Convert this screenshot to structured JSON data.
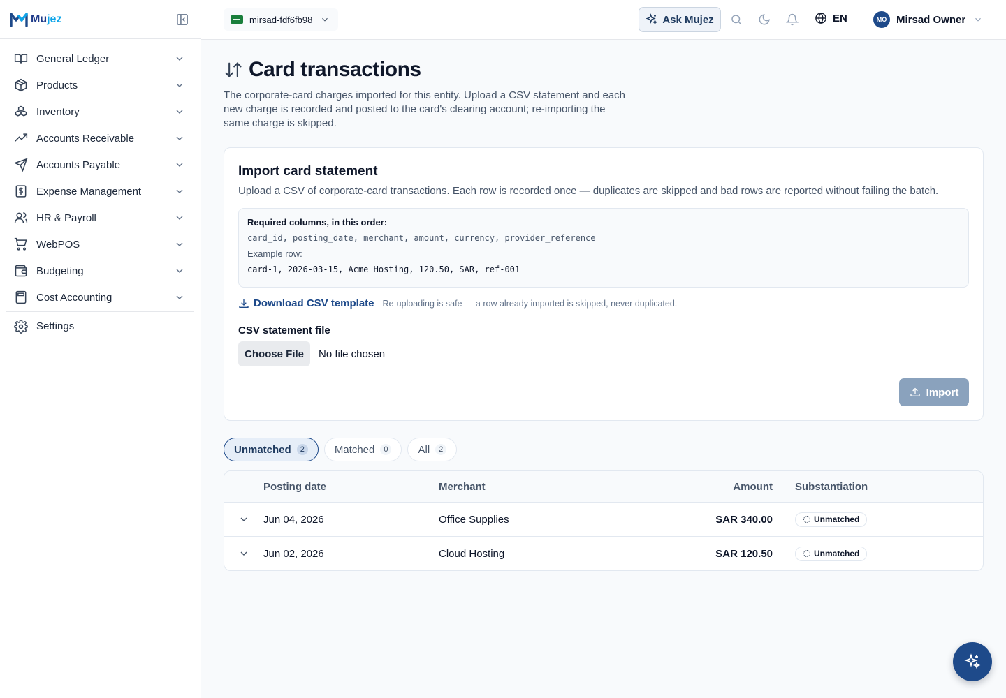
{
  "brand": {
    "name_prefix": "Mu",
    "name_suffix": "jez"
  },
  "sidebar": {
    "items": [
      {
        "label": "General Ledger",
        "icon": "book-open-icon"
      },
      {
        "label": "Products",
        "icon": "package-icon"
      },
      {
        "label": "Inventory",
        "icon": "boxes-icon"
      },
      {
        "label": "Accounts Receivable",
        "icon": "trending-up-icon"
      },
      {
        "label": "Accounts Payable",
        "icon": "send-icon"
      },
      {
        "label": "Expense Management",
        "icon": "receipt-icon"
      },
      {
        "label": "HR & Payroll",
        "icon": "users-icon"
      },
      {
        "label": "WebPOS",
        "icon": "cart-icon"
      },
      {
        "label": "Budgeting",
        "icon": "wallet-icon"
      },
      {
        "label": "Cost Accounting",
        "icon": "calculator-icon"
      }
    ],
    "settings_label": "Settings"
  },
  "topbar": {
    "entity": "mirsad-fdf6fb98",
    "ask_label": "Ask Mujez",
    "language": "EN",
    "user_initials": "MO",
    "user_name": "Mirsad Owner"
  },
  "page": {
    "title": "Card transactions",
    "subtitle": "The corporate-card charges imported for this entity. Upload a CSV statement and each new charge is recorded and posted to the card's clearing account; re-importing the same charge is skipped."
  },
  "import_card": {
    "title": "Import card statement",
    "description": "Upload a CSV of corporate-card transactions. Each row is recorded once — duplicates are skipped and bad rows are reported without failing the batch.",
    "required_heading": "Required columns, in this order:",
    "columns": "card_id, posting_date, merchant, amount, currency, provider_reference",
    "example_label": "Example row:",
    "example_row": "card-1, 2026-03-15, Acme Hosting, 120.50, SAR, ref-001",
    "download_label": "Download CSV template",
    "download_note": "Re-uploading is safe — a row already imported is skipped, never duplicated.",
    "file_label": "CSV statement file",
    "choose_label": "Choose File",
    "no_file": "No file chosen",
    "import_label": "Import"
  },
  "tabs": [
    {
      "label": "Unmatched",
      "count": "2"
    },
    {
      "label": "Matched",
      "count": "0"
    },
    {
      "label": "All",
      "count": "2"
    }
  ],
  "table": {
    "headers": {
      "date": "Posting date",
      "merchant": "Merchant",
      "amount": "Amount",
      "substantiation": "Substantiation"
    },
    "rows": [
      {
        "date": "Jun 04, 2026",
        "merchant": "Office Supplies",
        "amount": "SAR 340.00",
        "status": "Unmatched"
      },
      {
        "date": "Jun 02, 2026",
        "merchant": "Cloud Hosting",
        "amount": "SAR 120.50",
        "status": "Unmatched"
      }
    ]
  },
  "colors": {
    "primary": "#1e4a8a",
    "import_disabled": "#8aa2bd"
  }
}
